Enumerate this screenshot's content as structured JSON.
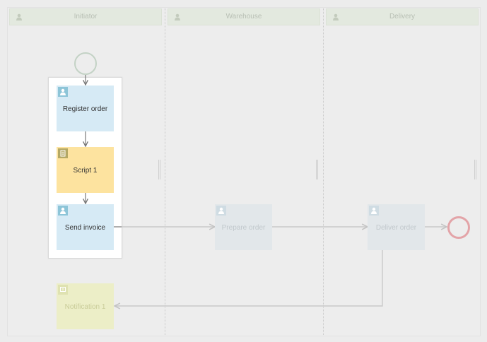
{
  "lanes": [
    {
      "label": "Initiator",
      "icon": "person-icon"
    },
    {
      "label": "Warehouse",
      "icon": "person-icon"
    },
    {
      "label": "Delivery",
      "icon": "person-icon"
    }
  ],
  "tasks": {
    "register_order": {
      "label": "Register order",
      "type": "user",
      "icon": "user-task-icon"
    },
    "script_1": {
      "label": "Script 1",
      "type": "script",
      "icon": "script-task-icon"
    },
    "send_invoice": {
      "label": "Send invoice",
      "type": "user",
      "icon": "user-task-icon"
    },
    "prepare_order": {
      "label": "Prepare order",
      "type": "user",
      "icon": "user-task-icon"
    },
    "deliver_order": {
      "label": "Deliver order",
      "type": "user",
      "icon": "user-task-icon"
    },
    "notification_1": {
      "label": "Notification 1",
      "type": "notification",
      "icon": "notification-task-icon"
    }
  },
  "events": {
    "start": {
      "type": "start",
      "color": "#c3d2c5"
    },
    "end": {
      "type": "end",
      "color": "#e3a4a8"
    }
  },
  "colors": {
    "user_task": "#d6eaf5",
    "script_task": "#fde39f",
    "lane_header": "#e3e9df",
    "connector": "#777777",
    "connector_dim": "#c9c9c9"
  }
}
